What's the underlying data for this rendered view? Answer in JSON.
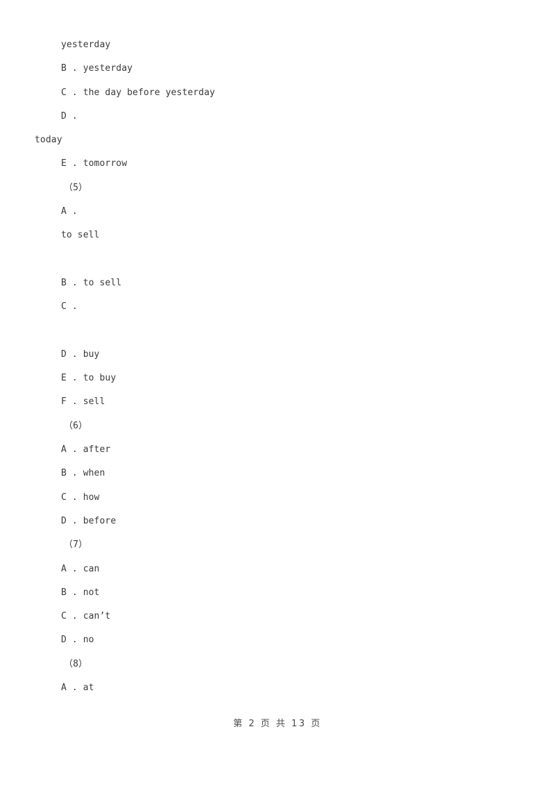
{
  "document": {
    "lines": [
      {
        "text": "yesterday",
        "indent": "opt"
      },
      {
        "text": "B . yesterday",
        "indent": "opt"
      },
      {
        "text": "C . the day before yesterday",
        "indent": "opt"
      },
      {
        "text": "D .",
        "indent": "opt"
      },
      {
        "text": "today",
        "indent": "outer"
      },
      {
        "text": "E . tomorrow",
        "indent": "opt"
      },
      {
        "text": "（5）",
        "indent": "num"
      },
      {
        "text": "A .",
        "indent": "opt"
      },
      {
        "text": "to sell",
        "indent": "opt"
      },
      {
        "text": "",
        "indent": "opt"
      },
      {
        "text": "B . to sell",
        "indent": "opt"
      },
      {
        "text": "C .",
        "indent": "opt"
      },
      {
        "text": "",
        "indent": "opt"
      },
      {
        "text": "D . buy",
        "indent": "opt"
      },
      {
        "text": "E . to buy",
        "indent": "opt"
      },
      {
        "text": "F . sell",
        "indent": "opt"
      },
      {
        "text": "（6）",
        "indent": "num"
      },
      {
        "text": "A . after",
        "indent": "opt"
      },
      {
        "text": "B . when",
        "indent": "opt"
      },
      {
        "text": "C . how",
        "indent": "opt"
      },
      {
        "text": "D . before",
        "indent": "opt"
      },
      {
        "text": "（7）",
        "indent": "num"
      },
      {
        "text": "A . can",
        "indent": "opt"
      },
      {
        "text": "B . not",
        "indent": "opt"
      },
      {
        "text": "C . can’t",
        "indent": "opt"
      },
      {
        "text": "D . no",
        "indent": "opt"
      },
      {
        "text": "（8）",
        "indent": "num"
      },
      {
        "text": "A . at",
        "indent": "opt"
      }
    ]
  },
  "footer": {
    "page_label": "第 2 页 共 13 页",
    "current_page": "2",
    "total_pages": "13"
  },
  "colors": {
    "background": "#ffffff",
    "text": "#3a3a3a",
    "footer_text": "#4a4a4a"
  }
}
